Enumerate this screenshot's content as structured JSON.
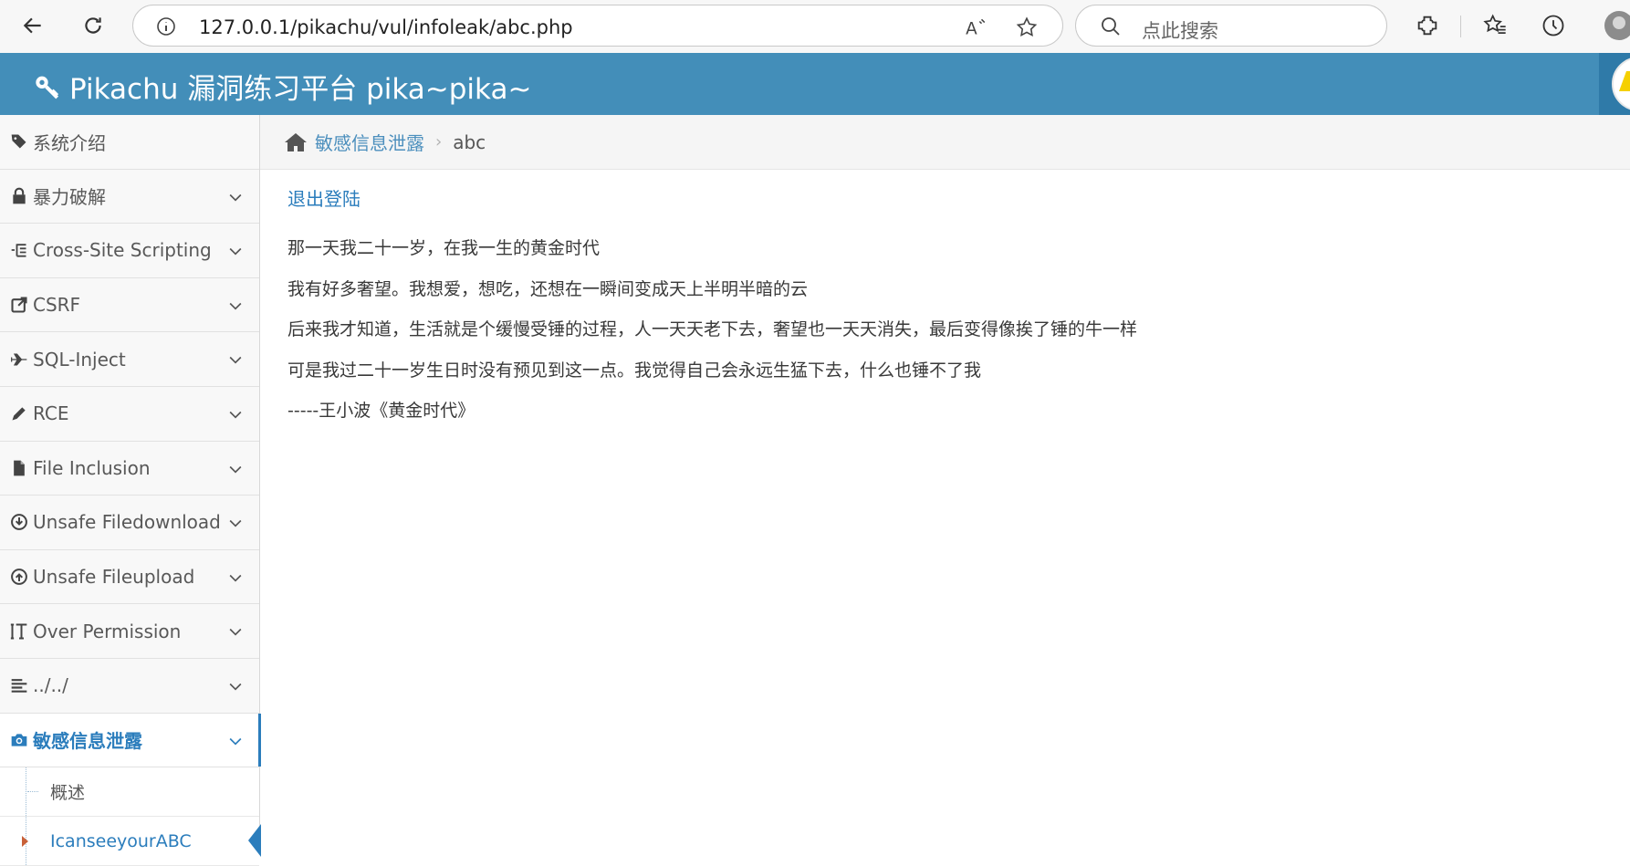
{
  "browser": {
    "url": "127.0.0.1/pikachu/vul/infoleak/abc.php",
    "search_placeholder": "点此搜索"
  },
  "header": {
    "title": "Pikachu 漏洞练习平台 pika~pika~"
  },
  "sidebar": {
    "items": [
      {
        "label": "系统介绍",
        "icon": "tags-icon",
        "expandable": false
      },
      {
        "label": "暴力破解",
        "icon": "lock-icon",
        "expandable": true
      },
      {
        "label": "Cross-Site Scripting",
        "icon": "list-icon",
        "expandable": true
      },
      {
        "label": "CSRF",
        "icon": "share-icon",
        "expandable": true
      },
      {
        "label": "SQL-Inject",
        "icon": "plane-icon",
        "expandable": true
      },
      {
        "label": "RCE",
        "icon": "pencil-icon",
        "expandable": true
      },
      {
        "label": "File Inclusion",
        "icon": "file-icon",
        "expandable": true
      },
      {
        "label": "Unsafe Filedownload",
        "icon": "download-icon",
        "expandable": true
      },
      {
        "label": "Unsafe Fileupload",
        "icon": "upload-icon",
        "expandable": true
      },
      {
        "label": "Over Permission",
        "icon": "text-height-icon",
        "expandable": true
      },
      {
        "label": "../../",
        "icon": "align-left-icon",
        "expandable": true
      },
      {
        "label": "敏感信息泄露",
        "icon": "camera-icon",
        "expandable": true,
        "active": true
      }
    ],
    "sub_items": [
      {
        "label": "概述"
      },
      {
        "label": "IcanseeyourABC",
        "active": true
      }
    ]
  },
  "breadcrumb": {
    "home_link": "敏感信息泄露",
    "current": "abc"
  },
  "main": {
    "logout": "退出登陆",
    "poem": [
      "那一天我二十一岁，在我一生的黄金时代",
      "我有好多奢望。我想爱，想吃，还想在一瞬间变成天上半明半暗的云",
      "后来我才知道，生活就是个缓慢受锤的过程，人一天天老下去，奢望也一天天消失，最后变得像挨了锤的牛一样",
      "可是我过二十一岁生日时没有预见到这一点。我觉得自己会永远生猛下去，什么也锤不了我",
      "-----王小波《黄金时代》"
    ]
  },
  "colors": {
    "header_bg": "#438eb9",
    "accent": "#2b7dbc",
    "sidebar_bg": "#f2f2f2"
  }
}
